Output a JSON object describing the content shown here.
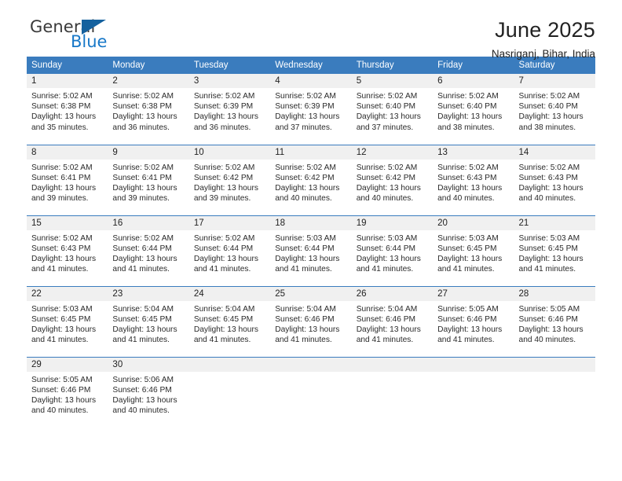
{
  "brand": {
    "word_general": "General",
    "word_blue": "Blue",
    "logo_icon": "triangle-logo-icon",
    "accent_color": "#1878c8",
    "triangle_color": "#15619e"
  },
  "header": {
    "title": "June 2025",
    "subtitle": "Nasriganj, Bihar, India"
  },
  "calendar": {
    "header_bg": "#3a7cbe",
    "daynum_bg": "#f0f0f0",
    "weekday_headers": [
      "Sunday",
      "Monday",
      "Tuesday",
      "Wednesday",
      "Thursday",
      "Friday",
      "Saturday"
    ],
    "weeks": [
      [
        {
          "day": "1",
          "sunrise": "Sunrise: 5:02 AM",
          "sunset": "Sunset: 6:38 PM",
          "daylight_1": "Daylight: 13 hours",
          "daylight_2": "and 35 minutes."
        },
        {
          "day": "2",
          "sunrise": "Sunrise: 5:02 AM",
          "sunset": "Sunset: 6:38 PM",
          "daylight_1": "Daylight: 13 hours",
          "daylight_2": "and 36 minutes."
        },
        {
          "day": "3",
          "sunrise": "Sunrise: 5:02 AM",
          "sunset": "Sunset: 6:39 PM",
          "daylight_1": "Daylight: 13 hours",
          "daylight_2": "and 36 minutes."
        },
        {
          "day": "4",
          "sunrise": "Sunrise: 5:02 AM",
          "sunset": "Sunset: 6:39 PM",
          "daylight_1": "Daylight: 13 hours",
          "daylight_2": "and 37 minutes."
        },
        {
          "day": "5",
          "sunrise": "Sunrise: 5:02 AM",
          "sunset": "Sunset: 6:40 PM",
          "daylight_1": "Daylight: 13 hours",
          "daylight_2": "and 37 minutes."
        },
        {
          "day": "6",
          "sunrise": "Sunrise: 5:02 AM",
          "sunset": "Sunset: 6:40 PM",
          "daylight_1": "Daylight: 13 hours",
          "daylight_2": "and 38 minutes."
        },
        {
          "day": "7",
          "sunrise": "Sunrise: 5:02 AM",
          "sunset": "Sunset: 6:40 PM",
          "daylight_1": "Daylight: 13 hours",
          "daylight_2": "and 38 minutes."
        }
      ],
      [
        {
          "day": "8",
          "sunrise": "Sunrise: 5:02 AM",
          "sunset": "Sunset: 6:41 PM",
          "daylight_1": "Daylight: 13 hours",
          "daylight_2": "and 39 minutes."
        },
        {
          "day": "9",
          "sunrise": "Sunrise: 5:02 AM",
          "sunset": "Sunset: 6:41 PM",
          "daylight_1": "Daylight: 13 hours",
          "daylight_2": "and 39 minutes."
        },
        {
          "day": "10",
          "sunrise": "Sunrise: 5:02 AM",
          "sunset": "Sunset: 6:42 PM",
          "daylight_1": "Daylight: 13 hours",
          "daylight_2": "and 39 minutes."
        },
        {
          "day": "11",
          "sunrise": "Sunrise: 5:02 AM",
          "sunset": "Sunset: 6:42 PM",
          "daylight_1": "Daylight: 13 hours",
          "daylight_2": "and 40 minutes."
        },
        {
          "day": "12",
          "sunrise": "Sunrise: 5:02 AM",
          "sunset": "Sunset: 6:42 PM",
          "daylight_1": "Daylight: 13 hours",
          "daylight_2": "and 40 minutes."
        },
        {
          "day": "13",
          "sunrise": "Sunrise: 5:02 AM",
          "sunset": "Sunset: 6:43 PM",
          "daylight_1": "Daylight: 13 hours",
          "daylight_2": "and 40 minutes."
        },
        {
          "day": "14",
          "sunrise": "Sunrise: 5:02 AM",
          "sunset": "Sunset: 6:43 PM",
          "daylight_1": "Daylight: 13 hours",
          "daylight_2": "and 40 minutes."
        }
      ],
      [
        {
          "day": "15",
          "sunrise": "Sunrise: 5:02 AM",
          "sunset": "Sunset: 6:43 PM",
          "daylight_1": "Daylight: 13 hours",
          "daylight_2": "and 41 minutes."
        },
        {
          "day": "16",
          "sunrise": "Sunrise: 5:02 AM",
          "sunset": "Sunset: 6:44 PM",
          "daylight_1": "Daylight: 13 hours",
          "daylight_2": "and 41 minutes."
        },
        {
          "day": "17",
          "sunrise": "Sunrise: 5:02 AM",
          "sunset": "Sunset: 6:44 PM",
          "daylight_1": "Daylight: 13 hours",
          "daylight_2": "and 41 minutes."
        },
        {
          "day": "18",
          "sunrise": "Sunrise: 5:03 AM",
          "sunset": "Sunset: 6:44 PM",
          "daylight_1": "Daylight: 13 hours",
          "daylight_2": "and 41 minutes."
        },
        {
          "day": "19",
          "sunrise": "Sunrise: 5:03 AM",
          "sunset": "Sunset: 6:44 PM",
          "daylight_1": "Daylight: 13 hours",
          "daylight_2": "and 41 minutes."
        },
        {
          "day": "20",
          "sunrise": "Sunrise: 5:03 AM",
          "sunset": "Sunset: 6:45 PM",
          "daylight_1": "Daylight: 13 hours",
          "daylight_2": "and 41 minutes."
        },
        {
          "day": "21",
          "sunrise": "Sunrise: 5:03 AM",
          "sunset": "Sunset: 6:45 PM",
          "daylight_1": "Daylight: 13 hours",
          "daylight_2": "and 41 minutes."
        }
      ],
      [
        {
          "day": "22",
          "sunrise": "Sunrise: 5:03 AM",
          "sunset": "Sunset: 6:45 PM",
          "daylight_1": "Daylight: 13 hours",
          "daylight_2": "and 41 minutes."
        },
        {
          "day": "23",
          "sunrise": "Sunrise: 5:04 AM",
          "sunset": "Sunset: 6:45 PM",
          "daylight_1": "Daylight: 13 hours",
          "daylight_2": "and 41 minutes."
        },
        {
          "day": "24",
          "sunrise": "Sunrise: 5:04 AM",
          "sunset": "Sunset: 6:45 PM",
          "daylight_1": "Daylight: 13 hours",
          "daylight_2": "and 41 minutes."
        },
        {
          "day": "25",
          "sunrise": "Sunrise: 5:04 AM",
          "sunset": "Sunset: 6:46 PM",
          "daylight_1": "Daylight: 13 hours",
          "daylight_2": "and 41 minutes."
        },
        {
          "day": "26",
          "sunrise": "Sunrise: 5:04 AM",
          "sunset": "Sunset: 6:46 PM",
          "daylight_1": "Daylight: 13 hours",
          "daylight_2": "and 41 minutes."
        },
        {
          "day": "27",
          "sunrise": "Sunrise: 5:05 AM",
          "sunset": "Sunset: 6:46 PM",
          "daylight_1": "Daylight: 13 hours",
          "daylight_2": "and 41 minutes."
        },
        {
          "day": "28",
          "sunrise": "Sunrise: 5:05 AM",
          "sunset": "Sunset: 6:46 PM",
          "daylight_1": "Daylight: 13 hours",
          "daylight_2": "and 40 minutes."
        }
      ],
      [
        {
          "day": "29",
          "sunrise": "Sunrise: 5:05 AM",
          "sunset": "Sunset: 6:46 PM",
          "daylight_1": "Daylight: 13 hours",
          "daylight_2": "and 40 minutes."
        },
        {
          "day": "30",
          "sunrise": "Sunrise: 5:06 AM",
          "sunset": "Sunset: 6:46 PM",
          "daylight_1": "Daylight: 13 hours",
          "daylight_2": "and 40 minutes."
        },
        {
          "day": "",
          "sunrise": "",
          "sunset": "",
          "daylight_1": "",
          "daylight_2": ""
        },
        {
          "day": "",
          "sunrise": "",
          "sunset": "",
          "daylight_1": "",
          "daylight_2": ""
        },
        {
          "day": "",
          "sunrise": "",
          "sunset": "",
          "daylight_1": "",
          "daylight_2": ""
        },
        {
          "day": "",
          "sunrise": "",
          "sunset": "",
          "daylight_1": "",
          "daylight_2": ""
        },
        {
          "day": "",
          "sunrise": "",
          "sunset": "",
          "daylight_1": "",
          "daylight_2": ""
        }
      ]
    ]
  }
}
